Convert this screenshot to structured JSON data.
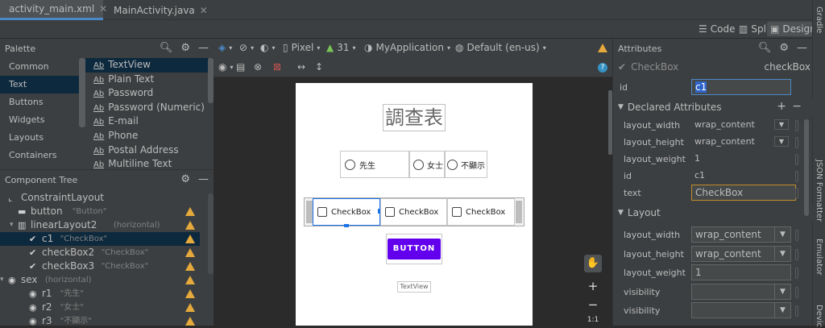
{
  "tabs": [
    {
      "label": "activity_main.xml",
      "active": true
    },
    {
      "label": "MainActivity.java",
      "active": false
    }
  ],
  "view_modes": {
    "code": "Code",
    "split": "Split",
    "design": "Design"
  },
  "gutter": {
    "gradle": "Gradle",
    "json": "JSON Formatter",
    "emulator": "Emulator",
    "device": "Devic"
  },
  "palette": {
    "title": "Palette",
    "categories": [
      "Common",
      "Text",
      "Buttons",
      "Widgets",
      "Layouts",
      "Containers"
    ],
    "selected_category": "Text",
    "items": [
      "TextView",
      "Plain Text",
      "Password",
      "Password (Numeric)",
      "E-mail",
      "Phone",
      "Postal Address",
      "Multiline Text"
    ],
    "item_prefix": "Ab"
  },
  "component_tree": {
    "title": "Component Tree",
    "nodes": [
      {
        "label": "ConstraintLayout",
        "sub": "",
        "warn": false
      },
      {
        "label": "button",
        "sub": "\"Button\"",
        "warn": true
      },
      {
        "label": "linearLayout2",
        "sub": "(horizontal)",
        "warn": true
      },
      {
        "label": "c1",
        "sub": "\"CheckBox\"",
        "warn": true
      },
      {
        "label": "checkBox2",
        "sub": "\"CheckBox\"",
        "warn": true
      },
      {
        "label": "checkBox3",
        "sub": "\"CheckBox\"",
        "warn": true
      },
      {
        "label": "sex",
        "sub": "(horizontal)",
        "warn": true
      },
      {
        "label": "r1",
        "sub": "\"先生\"",
        "warn": true
      },
      {
        "label": "r2",
        "sub": "\"女士\"",
        "warn": true
      },
      {
        "label": "r3",
        "sub": "\"不顯示\"",
        "warn": true
      }
    ]
  },
  "design_toolbar": {
    "device": "Pixel",
    "api": "31",
    "theme": "MyApplication",
    "locale": "Default (en-us)"
  },
  "phone": {
    "title": "調查表",
    "radios": [
      "先生",
      "女士",
      "不顯示"
    ],
    "checkboxes": [
      "CheckBox",
      "CheckBox",
      "CheckBox"
    ],
    "button": "BUTTON",
    "textview": "TextView"
  },
  "zoom": {
    "ratio": "1:1"
  },
  "attributes": {
    "title": "Attributes",
    "widget_type": "CheckBox",
    "widget_class": "checkBox",
    "id_label": "id",
    "id_value": "c1",
    "declared_title": "Declared Attributes",
    "declared": [
      {
        "k": "layout_width",
        "v": "wrap_content"
      },
      {
        "k": "layout_height",
        "v": "wrap_content"
      },
      {
        "k": "layout_weight",
        "v": "1"
      },
      {
        "k": "id",
        "v": "c1"
      },
      {
        "k": "text",
        "v": "CheckBox"
      }
    ],
    "layout_title": "Layout",
    "layout": [
      {
        "k": "layout_width",
        "v": "wrap_content"
      },
      {
        "k": "layout_height",
        "v": "wrap_content"
      },
      {
        "k": "layout_weight",
        "v": "1"
      },
      {
        "k": "visibility",
        "v": ""
      },
      {
        "k": "visibility",
        "v": ""
      }
    ]
  },
  "colors": {
    "accent": "#4a88c7",
    "warning": "#e5a93c",
    "button": "#6200ee",
    "selection": "#0d293e"
  }
}
